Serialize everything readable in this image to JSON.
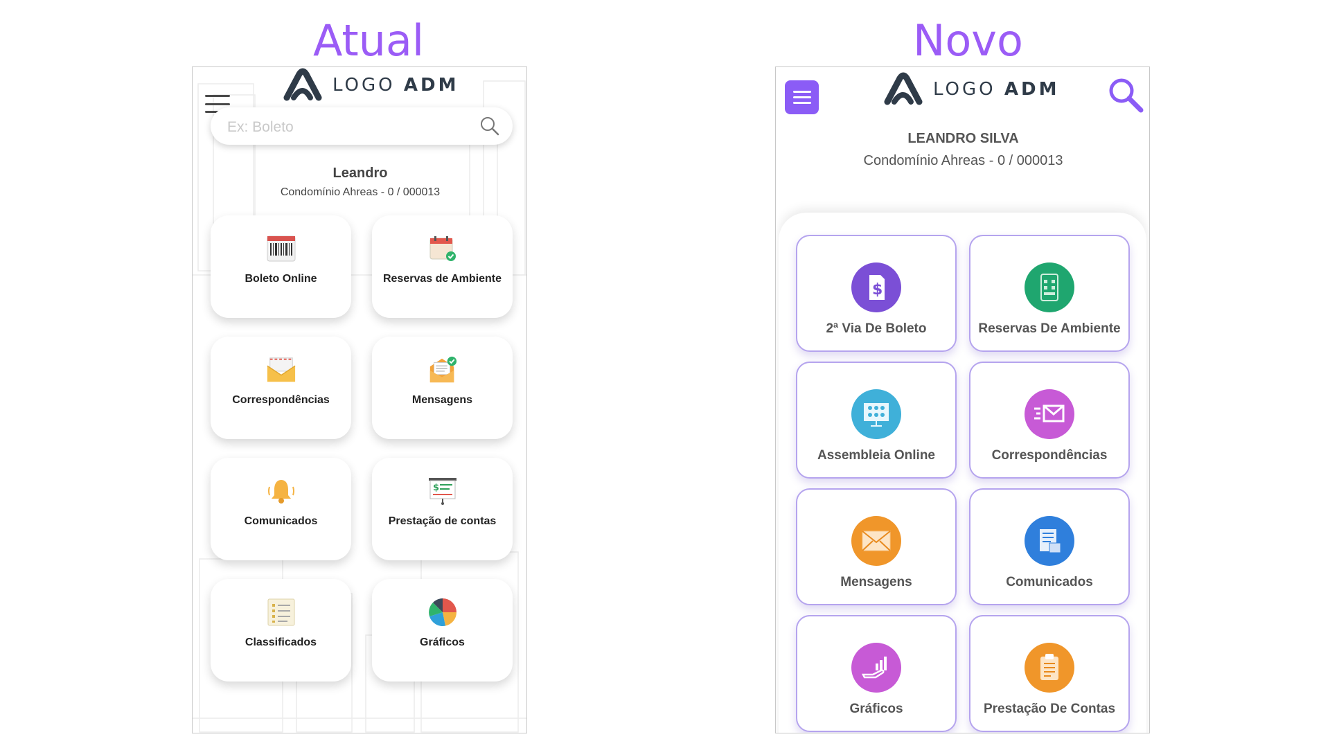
{
  "titles": {
    "old": "Atual",
    "new": "Novo"
  },
  "logo": {
    "light": "LOGO ",
    "bold": "ADM"
  },
  "old_screen": {
    "search_placeholder": "Ex: Boleto",
    "user_name": "Leandro",
    "condo": "Condomínio Ahreas - 0 / 000013",
    "cards": [
      {
        "label": "Boleto Online",
        "icon": "barcode-icon"
      },
      {
        "label": "Reservas de Ambiente",
        "icon": "calendar-check-icon"
      },
      {
        "label": "Correspondências",
        "icon": "envelope-icon"
      },
      {
        "label": "Mensagens",
        "icon": "mail-check-icon"
      },
      {
        "label": "Comunicados",
        "icon": "bell-icon"
      },
      {
        "label": "Prestação de contas",
        "icon": "presentation-board-icon"
      },
      {
        "label": "Classificados",
        "icon": "list-icon"
      },
      {
        "label": "Gráficos",
        "icon": "pie-chart-icon"
      }
    ]
  },
  "new_screen": {
    "user_name": "LEANDRO SILVA",
    "condo": "Condomínio Ahreas - 0 / 000013",
    "cards": [
      {
        "label": "2ª Via De Boleto",
        "icon": "invoice-dollar-icon",
        "color": "#7b4fd6"
      },
      {
        "label": "Reservas De Ambiente",
        "icon": "building-phone-icon",
        "color": "#1fa66f"
      },
      {
        "label": "Assembleia Online",
        "icon": "meeting-screen-icon",
        "color": "#3fb0d9"
      },
      {
        "label": "Correspondências",
        "icon": "fast-mail-icon",
        "color": "#c75ad6"
      },
      {
        "label": "Mensagens",
        "icon": "open-envelope-icon",
        "color": "#f0962a"
      },
      {
        "label": "Comunicados",
        "icon": "newspaper-icon",
        "color": "#2f7fdc"
      },
      {
        "label": "Gráficos",
        "icon": "growth-hand-icon",
        "color": "#c75ad6"
      },
      {
        "label": "Prestação De Contas",
        "icon": "clipboard-icon",
        "color": "#f0962a"
      }
    ]
  },
  "colors": {
    "accent": "#8b5cf6",
    "card_border": "#b5a4ee"
  }
}
